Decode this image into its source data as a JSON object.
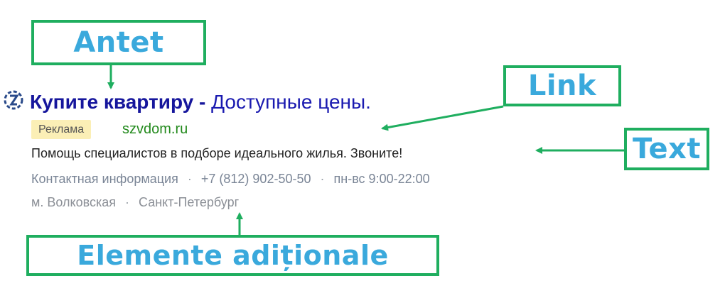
{
  "callouts": {
    "header": "Antet",
    "link": "Link",
    "text": "Text",
    "extras": "Elemente adiționale"
  },
  "ad": {
    "icon": "yandex-logo-icon",
    "title_strong": "Купите квартиру",
    "title_sep": " - ",
    "title_rest": "Доступные цены.",
    "badge": "Реклама",
    "domain": "szvdom.ru",
    "description": "Помощь специалистов в подборе идеального жилья. Звоните!",
    "contact_link": "Контактная информация",
    "phone": "+7 (812) 902-50-50",
    "hours": "пн-вс 9:00-22:00",
    "metro": "м. Волковская",
    "city": "Санкт-Петербург",
    "separator": "·"
  },
  "colors": {
    "callout_border": "#1fae5f",
    "callout_text": "#3aa9dc",
    "title": "#1a1ab0",
    "domain": "#238a1d",
    "badge_bg": "#fbefb6"
  }
}
